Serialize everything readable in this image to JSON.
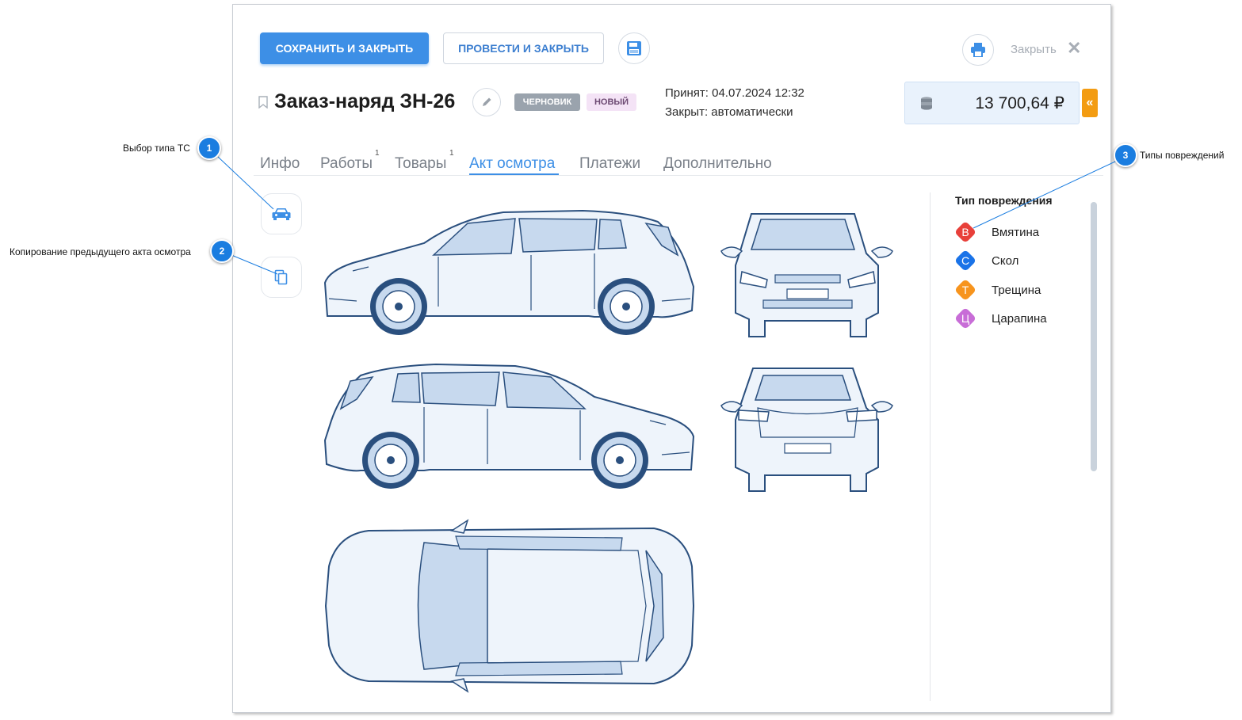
{
  "toolbar": {
    "save_close": "СОХРАНИТЬ И ЗАКРЫТЬ",
    "post_close": "ПРОВЕСТИ И ЗАКРЫТЬ",
    "close": "Закрыть"
  },
  "header": {
    "title": "Заказ-наряд ЗН-26",
    "badges": [
      "ЧЕРНОВИК",
      "НОВЫЙ"
    ],
    "accepted": "Принят: 04.07.2024 12:32",
    "closed": "Закрыт: автоматически",
    "total": "13 700,64 ₽"
  },
  "tabs": [
    {
      "label": "Инфо",
      "count": ""
    },
    {
      "label": "Работы",
      "count": "1"
    },
    {
      "label": "Товары",
      "count": "1"
    },
    {
      "label": "Акт осмотра",
      "count": "",
      "active": true
    },
    {
      "label": "Платежи",
      "count": ""
    },
    {
      "label": "Дополнительно",
      "count": ""
    }
  ],
  "damage_types": {
    "title": "Тип повреждения",
    "items": [
      {
        "letter": "В",
        "label": "Вмятина",
        "color": "#e8403a"
      },
      {
        "letter": "С",
        "label": "Скол",
        "color": "#1a73e8"
      },
      {
        "letter": "Т",
        "label": "Трещина",
        "color": "#f7941d"
      },
      {
        "letter": "Ц",
        "label": "Царапина",
        "color": "#c86dd7"
      }
    ]
  },
  "callouts": [
    {
      "number": "1",
      "text": "Выбор типа ТС"
    },
    {
      "number": "2",
      "text": "Копирование предыдущего акта осмотра"
    },
    {
      "number": "3",
      "text": "Типы повреждений"
    }
  ],
  "colors": {
    "accent": "#3d8fe6",
    "car_line": "#2a4f7e",
    "car_fill": "#eef4fb",
    "car_glass": "#c7d9ee",
    "collapse": "#f39c12"
  },
  "icons": {
    "save": "floppy-disk-icon",
    "print": "printer-icon",
    "close": "close-icon",
    "edit": "pencil-icon",
    "bookmark": "bookmark-icon",
    "coins": "coins-icon",
    "collapse": "double-chevron-left-icon",
    "vehicle_type": "car-icon",
    "copy": "copy-icon"
  }
}
